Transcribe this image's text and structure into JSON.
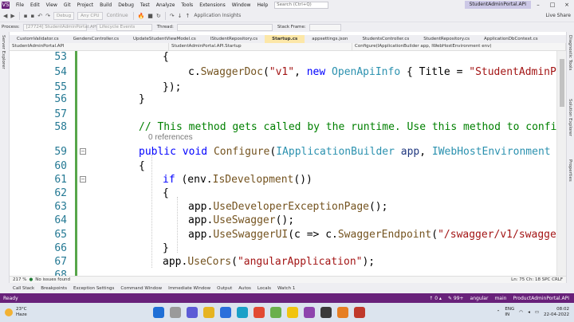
{
  "menubar": {
    "logo": "VS",
    "items": [
      "File",
      "Edit",
      "View",
      "Git",
      "Project",
      "Build",
      "Debug",
      "Test",
      "Analyze",
      "Tools",
      "Extensions",
      "Window",
      "Help"
    ],
    "search_placeholder": "Search (Ctrl+Q)",
    "solution_name": "StudentAdminPortal.API"
  },
  "toolbar": {
    "config": "Debug",
    "platform": "Any CPU",
    "continue_label": "Continue",
    "insights_label": "Application Insights",
    "live_share_label": "Live Share"
  },
  "procbar": {
    "process_label": "Process:",
    "process_value": "[27724] StudentAdminPortal.API.e",
    "lifecycle_label": "Lifecycle Events",
    "thread_label": "Thread:",
    "stack_label": "Stack Frame:"
  },
  "left_rail": [
    "Server Explorer"
  ],
  "right_rail": [
    "Diagnostic Tools",
    "Solution Explorer",
    "Properties"
  ],
  "tabs": [
    "CustomValidator.cs",
    "GendersController.cs",
    "UpdateStudentViewModel.cs",
    "IStudentRepository.cs",
    "Startup.cs",
    "appsettings.json",
    "StudentsController.cs",
    "StudentRepository.cs",
    "ApplicationDbContext.cs"
  ],
  "active_tab": "Startup.cs",
  "navbar": {
    "project": "StudentAdminPortal.API",
    "type": "StudentAdminPortal.API.Startup",
    "member": "Configure(IApplicationBuilder app, IWebHostEnvironment env)"
  },
  "editor": {
    "line_numbers": [
      "53",
      "54",
      "55",
      "56",
      "57",
      "58",
      "59",
      "60",
      "61",
      "62",
      "63",
      "64",
      "65",
      "66",
      "67",
      "68"
    ],
    "refs": "0 references",
    "code": {
      "l53": "{",
      "l54_a": "c.",
      "l54_fn": "SwaggerDoc",
      "l54_b": "(",
      "l54_str": "\"v1\"",
      "l54_c": ", ",
      "l54_kw": "new",
      "l54_d": " ",
      "l54_ty": "OpenApiInfo",
      "l54_e": " { ",
      "l54_p": "Title",
      "l54_f": " = ",
      "l54_str2": "\"StudentAdminPo",
      "l55": "});",
      "l56": "}",
      "l58": "// This method gets called by the runtime. Use this method to config",
      "l59_kw1": "public",
      "l59_kw2": "void",
      "l59_fn": "Configure",
      "l59_ty1": "IApplicationBuilder",
      "l59_p1": "app",
      "l59_ty2": "IWebHostEnvironment",
      "l59_end": "e",
      "l60": "{",
      "l61_kw": "if",
      "l61_a": " (env.",
      "l61_fn": "IsDevelopment",
      "l61_b": "())",
      "l62": "{",
      "l63_a": "app.",
      "l63_fn": "UseDeveloperExceptionPage",
      "l63_b": "();",
      "l64_a": "app.",
      "l64_fn": "UseSwagger",
      "l64_b": "();",
      "l65_a": "app.",
      "l65_fn": "UseSwaggerUI",
      "l65_b": "(c => c.",
      "l65_fn2": "SwaggerEndpoint",
      "l65_c": "(",
      "l65_str": "\"/swagger/v1/swagger",
      "l66": "}",
      "l67_a": "app.",
      "l67_fn": "UseCors",
      "l67_b": "(",
      "l67_str": "\"angularApplication\"",
      "l67_c": ");"
    }
  },
  "edstatus": {
    "zoom": "217 %",
    "issues": "No issues found",
    "position": "Ln: 75    Ch: 18    SPC    CRLF"
  },
  "bottom_tabs": [
    "Call Stack",
    "Breakpoints",
    "Exception Settings",
    "Command Window",
    "Immediate Window",
    "Output",
    "Autos",
    "Locals",
    "Watch 1"
  ],
  "statusbar": {
    "state": "Ready",
    "arrows": "↑ 0 ▴",
    "pencil": "✎ 99+",
    "repo_tool": "angular",
    "branch": "main",
    "repo": "ProductAdminPortal.API"
  },
  "taskbar": {
    "temp": "23°C",
    "weather": "Haze",
    "lang": "ENG",
    "region": "IN",
    "time": "08:02",
    "date": "22-04-2022"
  }
}
